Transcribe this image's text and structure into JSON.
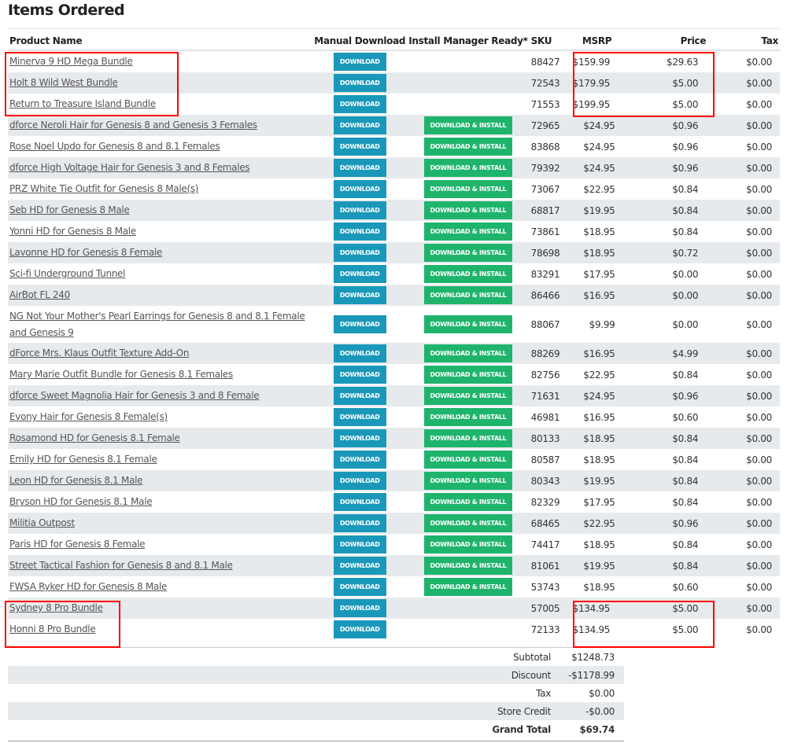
{
  "title": "Items Ordered",
  "headers": {
    "name": "Product Name",
    "manual": "Manual Download",
    "install": "Install Manager Ready*",
    "sku": "SKU",
    "msrp": "MSRP",
    "price": "Price",
    "tax": "Tax"
  },
  "download_label": "DOWNLOAD",
  "install_label": "DOWNLOAD & INSTALL",
  "items": [
    {
      "name": "Minerva 9 HD Mega Bundle",
      "install": false,
      "sku": "88427",
      "msrp": "$159.99",
      "price": "$29.63",
      "tax": "$0.00"
    },
    {
      "name": "Holt 8 Wild West Bundle",
      "install": false,
      "sku": "72543",
      "msrp": "$179.95",
      "price": "$5.00",
      "tax": "$0.00"
    },
    {
      "name": "Return to Treasure Island Bundle",
      "install": false,
      "sku": "71553",
      "msrp": "$199.95",
      "price": "$5.00",
      "tax": "$0.00"
    },
    {
      "name": "dforce Neroli Hair for Genesis 8 and Genesis 3 Females",
      "install": true,
      "sku": "72965",
      "msrp": "$24.95",
      "price": "$0.96",
      "tax": "$0.00"
    },
    {
      "name": "Rose Noel Updo for Genesis 8 and 8.1 Females",
      "install": true,
      "sku": "83868",
      "msrp": "$24.95",
      "price": "$0.96",
      "tax": "$0.00"
    },
    {
      "name": "dforce High Voltage Hair for Genesis 3 and 8 Females",
      "install": true,
      "sku": "79392",
      "msrp": "$24.95",
      "price": "$0.96",
      "tax": "$0.00"
    },
    {
      "name": "PRZ White Tie Outfit for Genesis 8 Male(s)",
      "install": true,
      "sku": "73067",
      "msrp": "$22.95",
      "price": "$0.84",
      "tax": "$0.00"
    },
    {
      "name": "Seb HD for Genesis 8 Male",
      "install": true,
      "sku": "68817",
      "msrp": "$19.95",
      "price": "$0.84",
      "tax": "$0.00"
    },
    {
      "name": "Yonni HD for Genesis 8 Male",
      "install": true,
      "sku": "73861",
      "msrp": "$18.95",
      "price": "$0.84",
      "tax": "$0.00"
    },
    {
      "name": "Lavonne HD for Genesis 8 Female",
      "install": true,
      "sku": "78698",
      "msrp": "$18.95",
      "price": "$0.72",
      "tax": "$0.00"
    },
    {
      "name": "Sci-fi Underground Tunnel",
      "install": true,
      "sku": "83291",
      "msrp": "$17.95",
      "price": "$0.00",
      "tax": "$0.00"
    },
    {
      "name": "AirBot FL 240",
      "install": true,
      "sku": "86466",
      "msrp": "$16.95",
      "price": "$0.00",
      "tax": "$0.00"
    },
    {
      "name": "NG Not Your Mother's Pearl Earrings for Genesis 8 and 8.1 Female and Genesis 9",
      "install": true,
      "sku": "88067",
      "msrp": "$9.99",
      "price": "$0.00",
      "tax": "$0.00"
    },
    {
      "name": "dForce Mrs. Klaus Outfit Texture Add-On",
      "install": true,
      "sku": "88269",
      "msrp": "$16.95",
      "price": "$4.99",
      "tax": "$0.00"
    },
    {
      "name": "Mary Marie Outfit Bundle for Genesis 8.1 Females",
      "install": true,
      "sku": "82756",
      "msrp": "$22.95",
      "price": "$0.84",
      "tax": "$0.00"
    },
    {
      "name": "dforce Sweet Magnolia Hair for Genesis 3 and 8 Female",
      "install": true,
      "sku": "71631",
      "msrp": "$24.95",
      "price": "$0.96",
      "tax": "$0.00"
    },
    {
      "name": "Evony Hair for Genesis 8 Female(s)",
      "install": true,
      "sku": "46981",
      "msrp": "$16.95",
      "price": "$0.60",
      "tax": "$0.00"
    },
    {
      "name": "Rosamond HD for Genesis 8.1 Female",
      "install": true,
      "sku": "80133",
      "msrp": "$18.95",
      "price": "$0.84",
      "tax": "$0.00"
    },
    {
      "name": "Emily HD for Genesis 8.1 Female",
      "install": true,
      "sku": "80587",
      "msrp": "$18.95",
      "price": "$0.84",
      "tax": "$0.00"
    },
    {
      "name": "Leon HD for Genesis 8.1 Male",
      "install": true,
      "sku": "80343",
      "msrp": "$19.95",
      "price": "$0.84",
      "tax": "$0.00"
    },
    {
      "name": "Bryson HD for Genesis 8.1 Male",
      "install": true,
      "sku": "82329",
      "msrp": "$17.95",
      "price": "$0.84",
      "tax": "$0.00"
    },
    {
      "name": "Militia Outpost",
      "install": true,
      "sku": "68465",
      "msrp": "$22.95",
      "price": "$0.96",
      "tax": "$0.00"
    },
    {
      "name": "Paris HD for Genesis 8 Female",
      "install": true,
      "sku": "74417",
      "msrp": "$18.95",
      "price": "$0.84",
      "tax": "$0.00"
    },
    {
      "name": "Street Tactical Fashion for Genesis 8 and 8.1 Male",
      "install": true,
      "sku": "81061",
      "msrp": "$19.95",
      "price": "$0.84",
      "tax": "$0.00"
    },
    {
      "name": "FWSA Ryker HD for Genesis 8 Male",
      "install": true,
      "sku": "53743",
      "msrp": "$18.95",
      "price": "$0.60",
      "tax": "$0.00"
    },
    {
      "name": "Sydney 8 Pro Bundle",
      "install": false,
      "sku": "57005",
      "msrp": "$134.95",
      "price": "$5.00",
      "tax": "$0.00"
    },
    {
      "name": "Honni 8 Pro Bundle",
      "install": false,
      "sku": "72133",
      "msrp": "$134.95",
      "price": "$5.00",
      "tax": "$0.00"
    }
  ],
  "summary": [
    {
      "label": "Subtotal",
      "value": "$1248.73"
    },
    {
      "label": "Discount",
      "value": "-$1178.99"
    },
    {
      "label": "Tax",
      "value": "$0.00"
    },
    {
      "label": "Store Credit",
      "value": "-$0.00"
    },
    {
      "label": "Grand Total",
      "value": "$69.74"
    }
  ]
}
